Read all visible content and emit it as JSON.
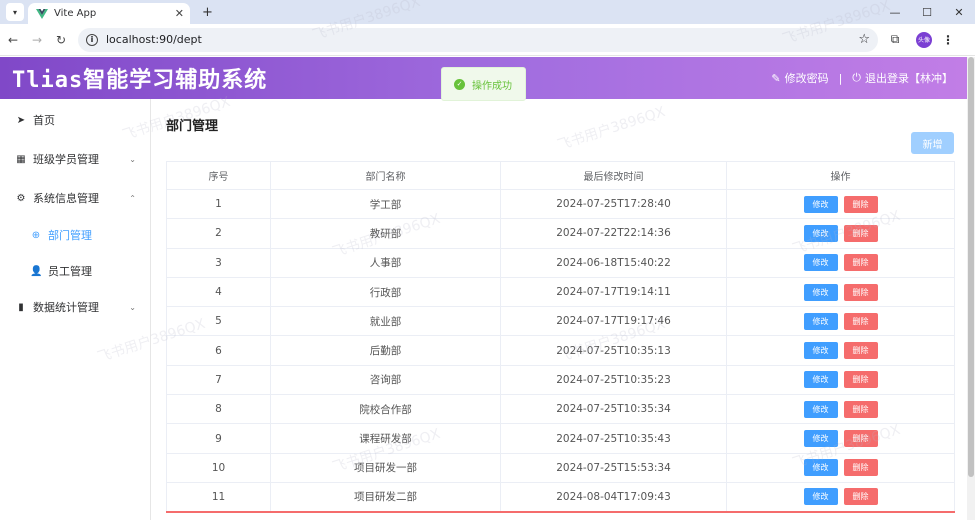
{
  "browser": {
    "tab_title": "Vite App",
    "url": "localhost:90/dept",
    "profile_label": "头像"
  },
  "app": {
    "logo": "Tlias智能学习辅助系统",
    "change_password": "修改密码",
    "separator": "|",
    "logout": "退出登录【林冲】",
    "toast": "操作成功"
  },
  "sidebar": {
    "items": [
      {
        "label": "首页",
        "icon": "send-icon"
      },
      {
        "label": "班级学员管理",
        "icon": "grid-icon"
      },
      {
        "label": "系统信息管理",
        "icon": "gear-icon"
      },
      {
        "label": "部门管理",
        "icon": "plus-circle-icon"
      },
      {
        "label": "员工管理",
        "icon": "user-icon"
      },
      {
        "label": "数据统计管理",
        "icon": "bar-chart-icon"
      }
    ]
  },
  "page": {
    "title": "部门管理",
    "add_button": "新增",
    "columns": [
      "序号",
      "部门名称",
      "最后修改时间",
      "操作"
    ],
    "edit_label": "修改",
    "delete_label": "删除",
    "rows": [
      {
        "no": "1",
        "name": "学工部",
        "time": "2024-07-25T17:28:40"
      },
      {
        "no": "2",
        "name": "教研部",
        "time": "2024-07-22T22:14:36"
      },
      {
        "no": "3",
        "name": "人事部",
        "time": "2024-06-18T15:40:22"
      },
      {
        "no": "4",
        "name": "行政部",
        "time": "2024-07-17T19:14:11"
      },
      {
        "no": "5",
        "name": "就业部",
        "time": "2024-07-17T19:17:46"
      },
      {
        "no": "6",
        "name": "后勤部",
        "time": "2024-07-25T10:35:13"
      },
      {
        "no": "7",
        "name": "咨询部",
        "time": "2024-07-25T10:35:23"
      },
      {
        "no": "8",
        "name": "院校合作部",
        "time": "2024-07-25T10:35:34"
      },
      {
        "no": "9",
        "name": "课程研发部",
        "time": "2024-07-25T10:35:43"
      },
      {
        "no": "10",
        "name": "项目研发一部",
        "time": "2024-07-25T15:53:34"
      },
      {
        "no": "11",
        "name": "项目研发二部",
        "time": "2024-08-04T17:09:43"
      }
    ]
  },
  "watermark": "飞书用户3896QX",
  "colors": {
    "primary": "#409eff",
    "danger": "#f56c6c",
    "success": "#67c23a",
    "header": "#a36ee0"
  }
}
